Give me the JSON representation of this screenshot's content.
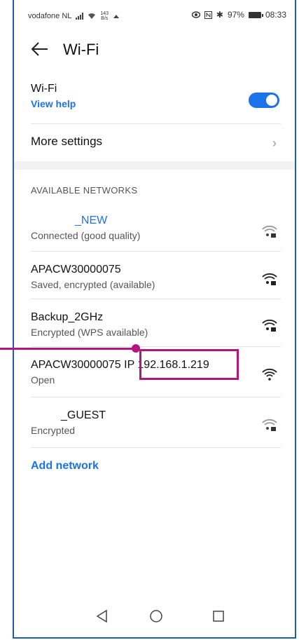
{
  "status_bar": {
    "carrier": "vodafone NL",
    "speed_value": "143",
    "speed_unit": "B/s",
    "battery": "97%",
    "time": "08:33"
  },
  "header": {
    "title": "Wi-Fi"
  },
  "wifi_toggle": {
    "label": "Wi-Fi",
    "help_link": "View help",
    "enabled": true
  },
  "more_settings": {
    "label": "More settings"
  },
  "available_networks": {
    "title": "AVAILABLE NETWORKS",
    "items": [
      {
        "name": "_NEW",
        "status": "Connected (good quality)",
        "icon": "wifi-lock-icon"
      },
      {
        "name": "APACW30000075",
        "status": "Saved, encrypted (available)",
        "icon": "wifi-lock-icon"
      },
      {
        "name": "Backup_2GHz",
        "status": "Encrypted (WPS available)",
        "icon": "wifi-lock-icon"
      },
      {
        "name": "APACW30000075 IP 192.168.1.219",
        "status": "Open",
        "icon": "wifi-icon"
      },
      {
        "name": "_GUEST",
        "status": "Encrypted",
        "icon": "wifi-lock-icon"
      }
    ]
  },
  "add_network": {
    "label": "Add network"
  },
  "nav": {
    "back": "back-nav-icon",
    "home": "home-nav-icon",
    "recents": "recents-nav-icon"
  },
  "colors": {
    "accent": "#1a73e8",
    "annotation": "#b5157e"
  }
}
